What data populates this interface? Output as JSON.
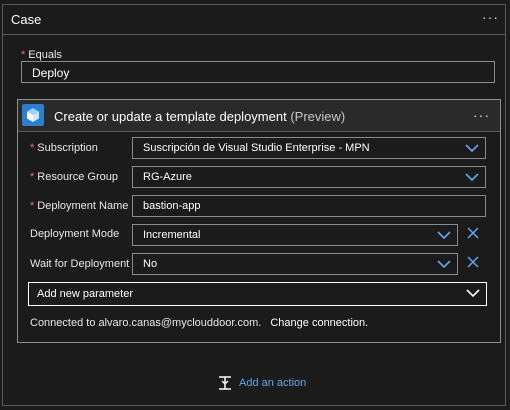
{
  "case": {
    "title": "Case",
    "menu_glyph": "···"
  },
  "equals": {
    "required_mark": "*",
    "label": "Equals",
    "value": "Deploy"
  },
  "action": {
    "icon": "template-deployment-icon",
    "title": "Create or update a template deployment",
    "preview_tag": "(Preview)",
    "menu_glyph": "···",
    "fields": {
      "subscription": {
        "required_mark": "*",
        "label": "Subscription",
        "value": "Suscripción de Visual Studio Enterprise - MPN"
      },
      "resource_group": {
        "required_mark": "*",
        "label": "Resource Group",
        "value": "RG-Azure"
      },
      "deployment_name": {
        "required_mark": "*",
        "label": "Deployment Name",
        "value": "bastion-app"
      },
      "deployment_mode": {
        "label": "Deployment Mode",
        "value": "Incremental"
      },
      "wait_for_deployment": {
        "label": "Wait for Deployment",
        "value": "No"
      }
    },
    "add_parameter": "Add new parameter",
    "connected_to": "Connected to alvaro.canas@myclouddoor.com.",
    "change_connection": "Change connection."
  },
  "add_action": {
    "label": "Add an action"
  },
  "colors": {
    "background": "#1b1b1b",
    "accent_blue": "#2c7ecf",
    "link_blue": "#62a8ef",
    "required_red": "#f26d6d",
    "border": "#8a8a8a"
  }
}
